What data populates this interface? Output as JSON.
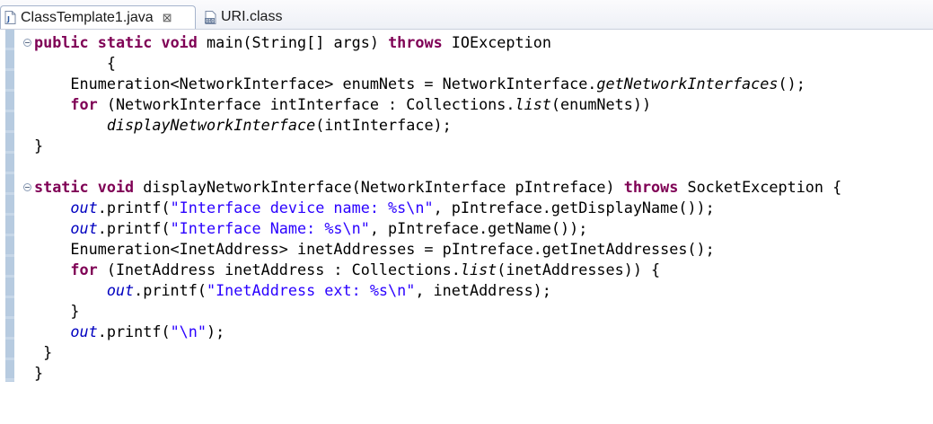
{
  "tabs": [
    {
      "label": "ClassTemplate1.java",
      "icon": "java-file-icon",
      "close": "⊠",
      "active": true
    },
    {
      "label": "URI.class",
      "icon": "class-file-icon",
      "active": false
    }
  ],
  "colors": {
    "keyword": "#7f0055",
    "string": "#2a00ff",
    "field": "#0000c0",
    "text": "#000000"
  },
  "code": {
    "lines": [
      [
        [
          "kw",
          "public"
        ],
        [
          "t",
          " "
        ],
        [
          "kw",
          "static"
        ],
        [
          "t",
          " "
        ],
        [
          "kw",
          "void"
        ],
        [
          "t",
          " main(String[] args) "
        ],
        [
          "kw",
          "throws"
        ],
        [
          "t",
          " IOException"
        ]
      ],
      [
        [
          "t",
          "        {"
        ]
      ],
      [
        [
          "t",
          "    Enumeration<NetworkInterface> enumNets = NetworkInterface."
        ],
        [
          "i",
          "getNetworkInterfaces"
        ],
        [
          "t",
          "();"
        ]
      ],
      [
        [
          "t",
          "    "
        ],
        [
          "kw",
          "for"
        ],
        [
          "t",
          " (NetworkInterface intInterface : Collections."
        ],
        [
          "i",
          "list"
        ],
        [
          "t",
          "(enumNets))"
        ]
      ],
      [
        [
          "t",
          "        "
        ],
        [
          "i",
          "displayNetworkInterface"
        ],
        [
          "t",
          "(intInterface);"
        ]
      ],
      [
        [
          "t",
          "}"
        ]
      ],
      [
        [
          "t",
          ""
        ]
      ],
      [
        [
          "kw",
          "static"
        ],
        [
          "t",
          " "
        ],
        [
          "kw",
          "void"
        ],
        [
          "t",
          " displayNetworkInterface(NetworkInterface pIntreface) "
        ],
        [
          "kw",
          "throws"
        ],
        [
          "t",
          " SocketException {"
        ]
      ],
      [
        [
          "t",
          "    "
        ],
        [
          "f",
          "out"
        ],
        [
          "t",
          ".printf("
        ],
        [
          "s",
          "\"Interface device name: %s\\n\""
        ],
        [
          "t",
          ", pIntreface.getDisplayName());"
        ]
      ],
      [
        [
          "t",
          "    "
        ],
        [
          "f",
          "out"
        ],
        [
          "t",
          ".printf("
        ],
        [
          "s",
          "\"Interface Name: %s\\n\""
        ],
        [
          "t",
          ", pIntreface.getName());"
        ]
      ],
      [
        [
          "t",
          "    Enumeration<InetAddress> inetAddresses = pIntreface.getInetAddresses();"
        ]
      ],
      [
        [
          "t",
          "    "
        ],
        [
          "kw",
          "for"
        ],
        [
          "t",
          " (InetAddress inetAddress : Collections."
        ],
        [
          "i",
          "list"
        ],
        [
          "t",
          "(inetAddresses)) {"
        ]
      ],
      [
        [
          "t",
          "        "
        ],
        [
          "f",
          "out"
        ],
        [
          "t",
          ".printf("
        ],
        [
          "s",
          "\"InetAddress ext: %s\\n\""
        ],
        [
          "t",
          ", inetAddress);"
        ]
      ],
      [
        [
          "t",
          "    }"
        ]
      ],
      [
        [
          "t",
          "    "
        ],
        [
          "f",
          "out"
        ],
        [
          "t",
          ".printf("
        ],
        [
          "s",
          "\"\\n\""
        ],
        [
          "t",
          ");"
        ]
      ],
      [
        [
          "t",
          " }"
        ]
      ],
      [
        [
          "t",
          "}"
        ]
      ]
    ]
  },
  "fold_markers": [
    0,
    7
  ]
}
